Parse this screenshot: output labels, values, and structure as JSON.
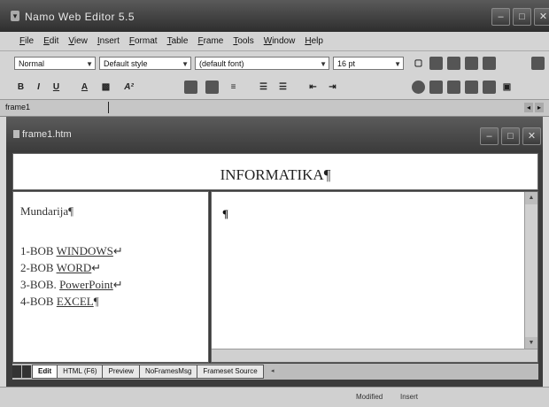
{
  "window": {
    "title": "Namo Web Editor 5.5"
  },
  "menubar": [
    "File",
    "Edit",
    "View",
    "Insert",
    "Format",
    "Table",
    "Frame",
    "Tools",
    "Window",
    "Help"
  ],
  "format_toolbar": {
    "paragraph_style": "Normal",
    "text_style": "Default style",
    "font": "(default font)",
    "font_size": "16 pt"
  },
  "frame_bar": {
    "frame_name": "frame1"
  },
  "document": {
    "title": "frame1.htm",
    "heading": "INFORMATIKA¶",
    "left_frame": {
      "heading": "Mundarija¶",
      "items": [
        {
          "prefix": "1-BOB ",
          "link": "WINDOWS",
          "suffix": "↵"
        },
        {
          "prefix": "2-BOB ",
          "link": "WORD",
          "suffix": "↵"
        },
        {
          "prefix": "3-BOB. ",
          "link": "PowerPoint",
          "suffix": "↵"
        },
        {
          "prefix": "4-BOB ",
          "link": "EXCEL",
          "suffix": "¶"
        }
      ]
    },
    "right_frame": {
      "content": "¶"
    }
  },
  "tabs": [
    "Edit",
    "HTML (F6)",
    "Preview",
    "NoFramesMsg",
    "Frameset Source"
  ],
  "active_tab": "Edit",
  "statusbar": {
    "modified": "Modified",
    "mode": "Insert"
  }
}
